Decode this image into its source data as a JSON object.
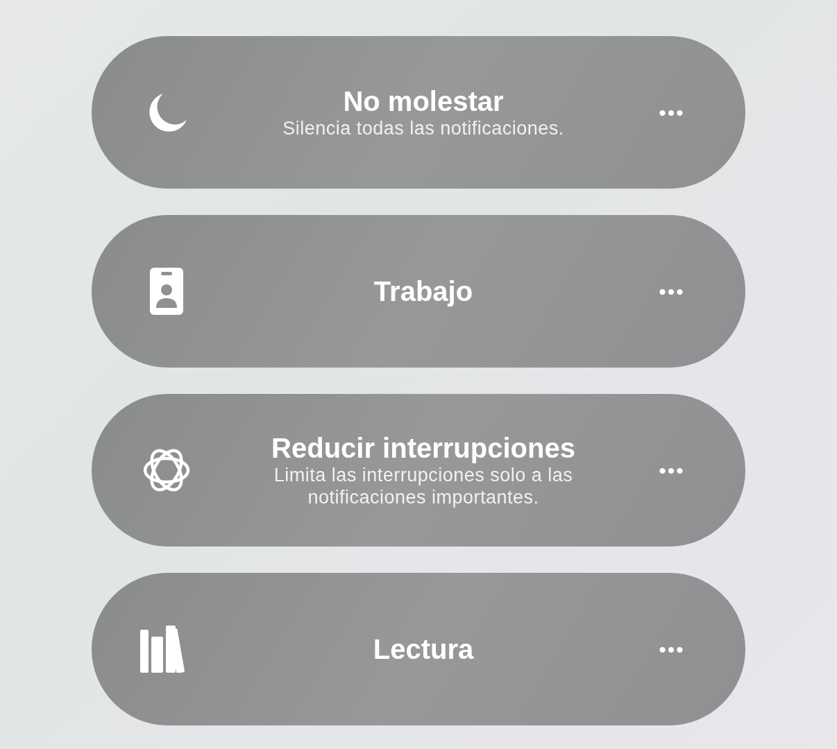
{
  "focus_modes": [
    {
      "kind": "sleep",
      "title": "No molestar",
      "subtitle": "Silencia todas las notificaciones.",
      "more": "•••"
    },
    {
      "kind": "work",
      "title": "Trabajo",
      "more": "•••"
    },
    {
      "kind": "focus",
      "title": "Reducir interrupciones",
      "subtitle": "Limita las interrupciones solo a las notificaciones importantes.",
      "more": "•••"
    },
    {
      "kind": "reading",
      "title": "Lectura",
      "more": "•••"
    }
  ]
}
